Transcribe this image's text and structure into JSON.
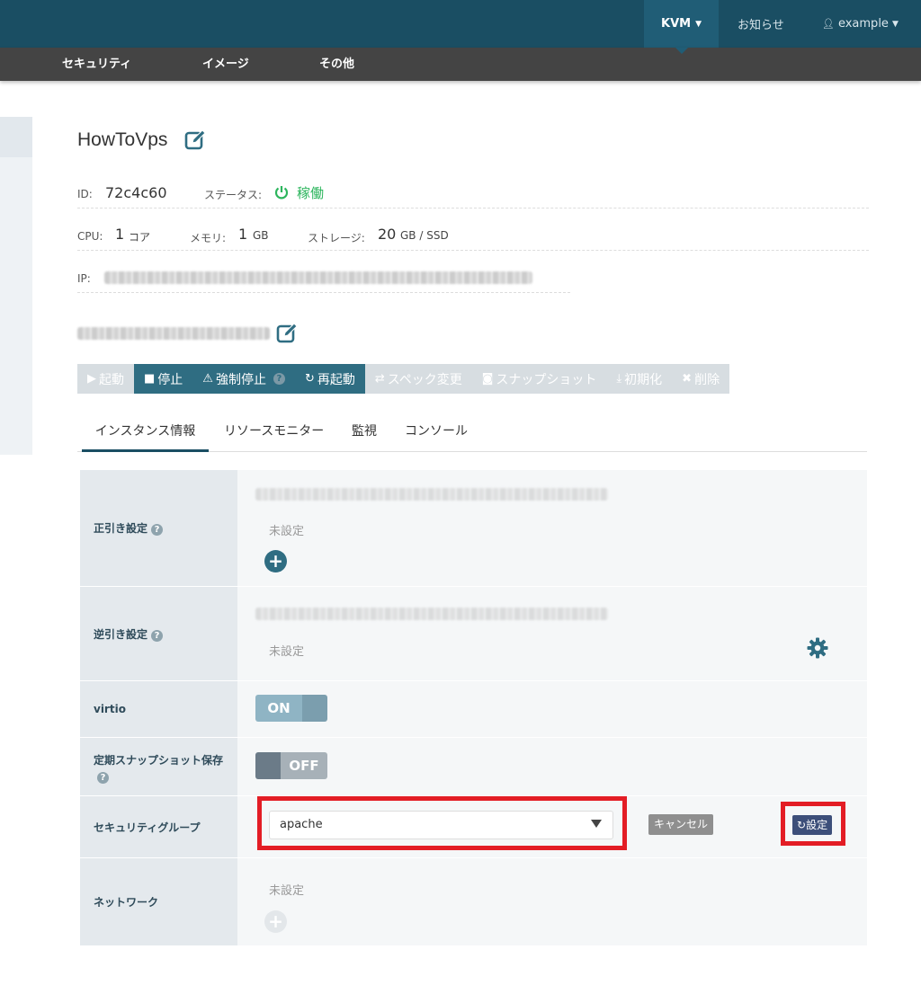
{
  "topbar": {
    "kvm_label": "KVM",
    "news_label": "お知らせ",
    "user_label": "example"
  },
  "subnav": {
    "items": [
      "セキュリティ",
      "イメージ",
      "その他"
    ]
  },
  "server": {
    "name": "HowToVps",
    "id_label": "ID:",
    "id_value": "72c4c60",
    "status_label": "ステータス:",
    "status_value": "稼働",
    "cpu_label": "CPU:",
    "cpu_value": "1",
    "cpu_unit": "コア",
    "memory_label": "メモリ:",
    "memory_value": "1",
    "memory_unit": "GB",
    "storage_label": "ストレージ:",
    "storage_value": "20",
    "storage_unit": "GB / SSD",
    "ip_label": "IP:"
  },
  "toolbar": {
    "start": "起動",
    "stop": "停止",
    "force_stop": "強制停止",
    "restart": "再起動",
    "spec_change": "スペック変更",
    "snapshot": "スナップショット",
    "initialize": "初期化",
    "delete": "削除"
  },
  "tabs": [
    "インスタンス情報",
    "リソースモニター",
    "監視",
    "コンソール"
  ],
  "settings": {
    "forward_dns": {
      "label": "正引き設定",
      "value": "未設定"
    },
    "reverse_dns": {
      "label": "逆引き設定",
      "value": "未設定"
    },
    "virtio": {
      "label": "virtio",
      "state": "ON"
    },
    "snapshot": {
      "label": "定期スナップショット保存",
      "state": "OFF"
    },
    "security_group": {
      "label": "セキュリティグループ",
      "selected": "apache",
      "cancel": "キャンセル",
      "submit": "設定"
    },
    "network": {
      "label": "ネットワーク",
      "value": "未設定"
    }
  },
  "colors": {
    "topbar": "#1a4e63",
    "accent": "#2f6d82",
    "status_green": "#2db55d",
    "highlight_red": "#e31d25"
  }
}
